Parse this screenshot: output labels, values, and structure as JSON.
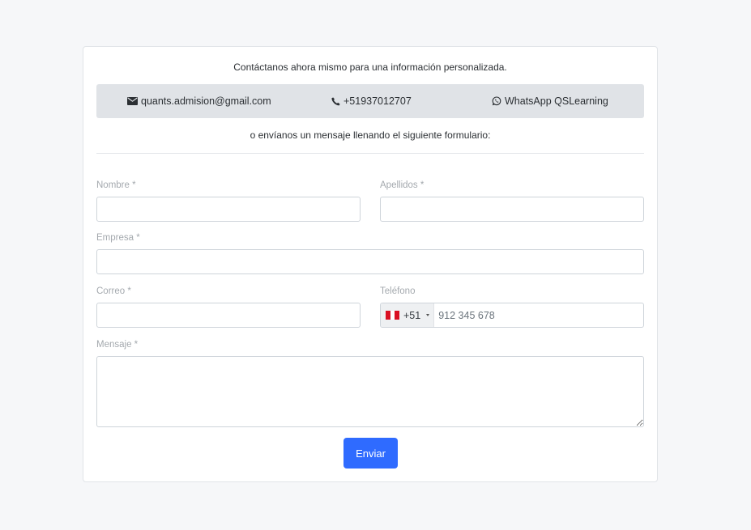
{
  "header": {
    "intro_text": "Contáctanos ahora mismo para una información personalizada.",
    "sub_intro_text": "o envíanos un mensaje llenando el siguiente formulario:"
  },
  "contact": {
    "email": {
      "icon": "envelope-icon",
      "label": "quants.admision@gmail.com"
    },
    "phone": {
      "icon": "phone-icon",
      "label": "+51937012707"
    },
    "whatsapp": {
      "icon": "whatsapp-icon",
      "label": "WhatsApp QSLearning"
    }
  },
  "form": {
    "nombre_label": "Nombre *",
    "apellidos_label": "Apellidos *",
    "empresa_label": "Empresa *",
    "correo_label": "Correo *",
    "telefono_label": "Teléfono",
    "telefono_country": {
      "flag": "peru-flag-icon",
      "dial_code": "+51"
    },
    "telefono_placeholder": "912 345 678",
    "mensaje_label": "Mensaje *",
    "nombre_value": "",
    "apellidos_value": "",
    "empresa_value": "",
    "correo_value": "",
    "mensaje_value": "",
    "submit_label": "Enviar"
  },
  "colors": {
    "accent": "#2f6bff",
    "page_background": "#f6f7f9",
    "contact_bar": "#e0e3e7",
    "peru_red": "#d91023"
  }
}
